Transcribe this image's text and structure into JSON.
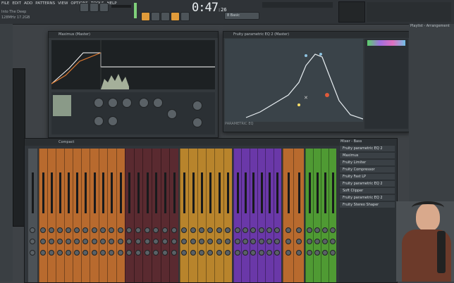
{
  "menu": [
    "FILE",
    "EDIT",
    "ADD",
    "PATTERNS",
    "VIEW",
    "OPTIONS",
    "TOOLS",
    "HELP"
  ],
  "project": {
    "name": "Into The Deep",
    "info": "128MHz  17.2GB"
  },
  "transport": {
    "time": "0:47",
    "time_suffix": ":26",
    "tempo": "8 Basic"
  },
  "plugin1": {
    "title": "Maximus (Master)"
  },
  "plugin2": {
    "title": "Fruity parametric EQ 2 (Master)",
    "logo": "PARAMETRIC EQ"
  },
  "playlist": {
    "title": "Playlist - Arrangement"
  },
  "mixer": {
    "title": "Compact",
    "inserts_title": "Mixer - Bass",
    "inserts": [
      "Fruity parametric EQ 2",
      "Maximus",
      "Fruity Limiter",
      "Fruity Compressor",
      "Fruity Fast LP",
      "Fruity parametric EQ 2",
      "Soft Clipper",
      "Fruity parametric EQ 2",
      "Fruity Stereo Shaper"
    ]
  },
  "colors": {
    "orange_group": "#b86a2e",
    "maroon_group": "#5a2a30",
    "gold_group": "#b8842c",
    "purple_group": "#6a38a8",
    "green_group": "#4f9a33",
    "accent": "#e09b3a"
  }
}
